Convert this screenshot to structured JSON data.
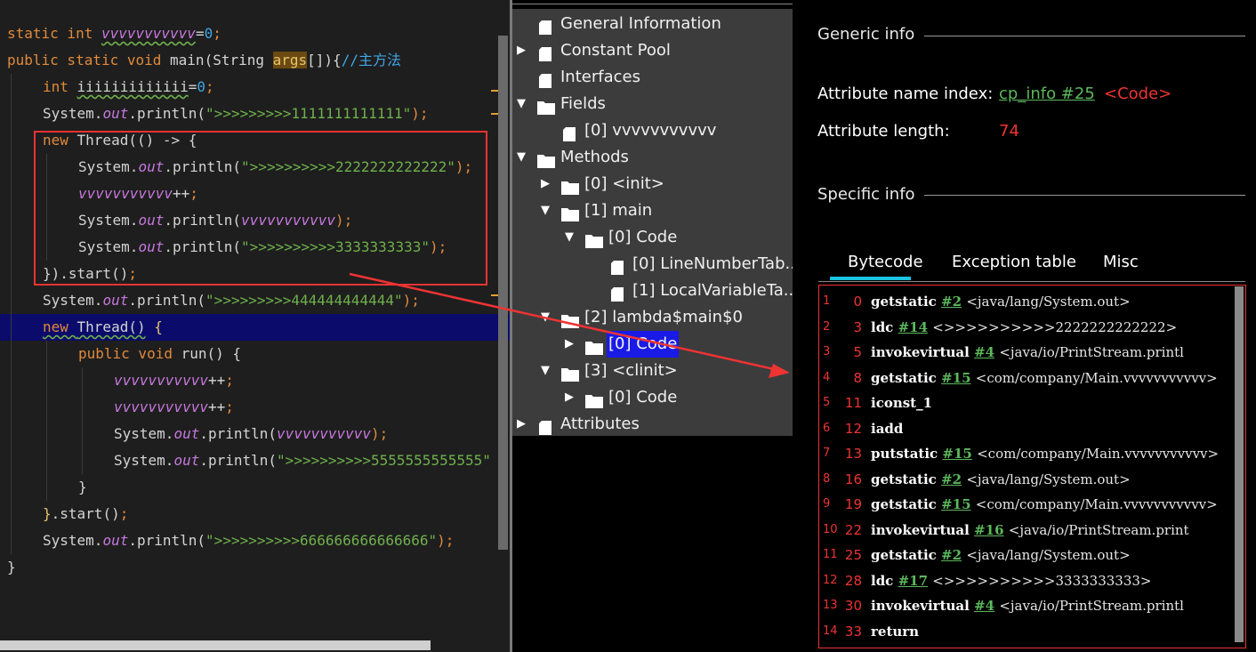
{
  "editor": {
    "lines": [
      {
        "indent": 0,
        "highlight": false,
        "tokens": [
          {
            "t": "static int ",
            "c": "kw"
          },
          {
            "t": "vvvvvvvvvvv",
            "c": "var",
            "w": true
          },
          {
            "t": "=",
            "c": "punc"
          },
          {
            "t": "0",
            "c": "num"
          },
          {
            "t": ";",
            "c": "semi"
          }
        ]
      },
      {
        "indent": 0,
        "highlight": false,
        "tokens": [
          {
            "t": "public static void ",
            "c": "kw"
          },
          {
            "t": "main",
            "c": "fn"
          },
          {
            "t": "(String ",
            "c": "punc"
          },
          {
            "t": "args",
            "c": "arg"
          },
          {
            "t": "[]){",
            "c": "punc"
          },
          {
            "t": "//主方法",
            "c": "cmt"
          }
        ]
      },
      {
        "indent": 1,
        "highlight": false,
        "tokens": [
          {
            "t": "int ",
            "c": "kw"
          },
          {
            "t": "iiiiiiiiiiiii",
            "c": "punc",
            "w": true
          },
          {
            "t": "=",
            "c": "punc"
          },
          {
            "t": "0",
            "c": "num"
          },
          {
            "t": ";",
            "c": "semi"
          }
        ]
      },
      {
        "indent": 1,
        "highlight": false,
        "tokens": [
          {
            "t": "System.",
            "c": "punc"
          },
          {
            "t": "out",
            "c": "field"
          },
          {
            "t": ".println(",
            "c": "punc"
          },
          {
            "t": "\">>>>>>>>>1111111111111\"",
            "c": "str"
          },
          {
            "t": ");",
            "c": "semi"
          }
        ]
      },
      {
        "indent": 1,
        "highlight": false,
        "tokens": [
          {
            "t": "new ",
            "c": "kw"
          },
          {
            "t": "Thread(() -> {",
            "c": "punc"
          }
        ]
      },
      {
        "indent": 2,
        "highlight": false,
        "tokens": [
          {
            "t": "System.",
            "c": "punc"
          },
          {
            "t": "out",
            "c": "field"
          },
          {
            "t": ".println(",
            "c": "punc"
          },
          {
            "t": "\">>>>>>>>>>2222222222222\"",
            "c": "str"
          },
          {
            "t": ");",
            "c": "semi"
          }
        ]
      },
      {
        "indent": 2,
        "highlight": false,
        "tokens": [
          {
            "t": "vvvvvvvvvvv",
            "c": "var"
          },
          {
            "t": "++",
            "c": "punc"
          },
          {
            "t": ";",
            "c": "semi"
          }
        ]
      },
      {
        "indent": 2,
        "highlight": false,
        "tokens": [
          {
            "t": "System.",
            "c": "punc"
          },
          {
            "t": "out",
            "c": "field"
          },
          {
            "t": ".println(",
            "c": "punc"
          },
          {
            "t": "vvvvvvvvvvv",
            "c": "var"
          },
          {
            "t": ");",
            "c": "semi"
          }
        ]
      },
      {
        "indent": 2,
        "highlight": false,
        "tokens": [
          {
            "t": "System.",
            "c": "punc"
          },
          {
            "t": "out",
            "c": "field"
          },
          {
            "t": ".println(",
            "c": "punc"
          },
          {
            "t": "\">>>>>>>>>>3333333333\"",
            "c": "str"
          },
          {
            "t": ");",
            "c": "semi"
          }
        ]
      },
      {
        "indent": 1,
        "highlight": false,
        "tokens": [
          {
            "t": "}).start()",
            "c": "punc"
          },
          {
            "t": ";",
            "c": "semi"
          }
        ]
      },
      {
        "indent": 1,
        "highlight": false,
        "tokens": [
          {
            "t": "System.",
            "c": "punc"
          },
          {
            "t": "out",
            "c": "field"
          },
          {
            "t": ".println(",
            "c": "punc"
          },
          {
            "t": "\">>>>>>>>>444444444444\"",
            "c": "str"
          },
          {
            "t": ");",
            "c": "semi"
          }
        ]
      },
      {
        "indent": 1,
        "highlight": true,
        "tokens": [
          {
            "t": "new ",
            "c": "kw",
            "w": true
          },
          {
            "t": "Thread()",
            "c": "punc",
            "w": true
          },
          {
            "t": " {",
            "c": "brace"
          }
        ]
      },
      {
        "indent": 2,
        "highlight": false,
        "tokens": [
          {
            "t": "public void ",
            "c": "kw"
          },
          {
            "t": "run",
            "c": "fn"
          },
          {
            "t": "() {",
            "c": "punc"
          }
        ]
      },
      {
        "indent": 3,
        "highlight": false,
        "tokens": [
          {
            "t": "vvvvvvvvvvv",
            "c": "var"
          },
          {
            "t": "++",
            "c": "punc"
          },
          {
            "t": ";",
            "c": "semi"
          }
        ]
      },
      {
        "indent": 3,
        "highlight": false,
        "tokens": [
          {
            "t": "vvvvvvvvvvv",
            "c": "var"
          },
          {
            "t": "++",
            "c": "punc"
          },
          {
            "t": ";",
            "c": "semi"
          }
        ]
      },
      {
        "indent": 3,
        "highlight": false,
        "tokens": [
          {
            "t": "System.",
            "c": "punc"
          },
          {
            "t": "out",
            "c": "field"
          },
          {
            "t": ".println(",
            "c": "punc"
          },
          {
            "t": "vvvvvvvvvvv",
            "c": "var"
          },
          {
            "t": ");",
            "c": "semi"
          }
        ]
      },
      {
        "indent": 3,
        "highlight": false,
        "tokens": [
          {
            "t": "System.",
            "c": "punc"
          },
          {
            "t": "out",
            "c": "field"
          },
          {
            "t": ".println(",
            "c": "punc"
          },
          {
            "t": "\">>>>>>>>>>5555555555555\"",
            "c": "str"
          }
        ]
      },
      {
        "indent": 2,
        "highlight": false,
        "tokens": [
          {
            "t": "}",
            "c": "punc"
          }
        ]
      },
      {
        "indent": 1,
        "highlight": false,
        "tokens": [
          {
            "t": "}",
            "c": "brace"
          },
          {
            "t": ".start()",
            "c": "punc"
          },
          {
            "t": ";",
            "c": "semi"
          }
        ]
      },
      {
        "indent": 1,
        "highlight": false,
        "tokens": [
          {
            "t": "System.",
            "c": "punc"
          },
          {
            "t": "out",
            "c": "field"
          },
          {
            "t": ".println(",
            "c": "punc"
          },
          {
            "t": "\">>>>>>>>>>666666666666666\"",
            "c": "str"
          },
          {
            "t": ");",
            "c": "semi"
          }
        ]
      },
      {
        "indent": 0,
        "highlight": false,
        "tokens": [
          {
            "t": "}",
            "c": "punc"
          }
        ]
      }
    ]
  },
  "tree": {
    "items": [
      {
        "label": "General Information",
        "level": 0,
        "twisty": "",
        "icon": "file",
        "selected": false
      },
      {
        "label": "Constant Pool",
        "level": 0,
        "twisty": "collapsed",
        "icon": "file",
        "selected": false
      },
      {
        "label": "Interfaces",
        "level": 0,
        "twisty": "",
        "icon": "file",
        "selected": false
      },
      {
        "label": "Fields",
        "level": 0,
        "twisty": "expanded",
        "icon": "folder",
        "selected": false
      },
      {
        "label": "[0] vvvvvvvvvvv",
        "level": 1,
        "twisty": "",
        "icon": "file",
        "selected": false
      },
      {
        "label": "Methods",
        "level": 0,
        "twisty": "expanded",
        "icon": "folder",
        "selected": false
      },
      {
        "label": "[0] <init>",
        "level": 1,
        "twisty": "collapsed",
        "icon": "folder",
        "selected": false
      },
      {
        "label": "[1] main",
        "level": 1,
        "twisty": "expanded",
        "icon": "folder",
        "selected": false
      },
      {
        "label": "[0] Code",
        "level": 2,
        "twisty": "expanded",
        "icon": "folder",
        "selected": false
      },
      {
        "label": "[0] LineNumberTab...",
        "level": 3,
        "twisty": "",
        "icon": "file",
        "selected": false
      },
      {
        "label": "[1] LocalVariableTa...",
        "level": 3,
        "twisty": "",
        "icon": "file",
        "selected": false
      },
      {
        "label": "[2] lambda$main$0",
        "level": 1,
        "twisty": "expanded",
        "icon": "folder",
        "selected": false
      },
      {
        "label": "[0] Code",
        "level": 2,
        "twisty": "collapsed",
        "icon": "folder",
        "selected": true
      },
      {
        "label": "[3] <clinit>",
        "level": 1,
        "twisty": "expanded",
        "icon": "folder",
        "selected": false
      },
      {
        "label": "[0] Code",
        "level": 2,
        "twisty": "collapsed",
        "icon": "folder",
        "selected": false
      },
      {
        "label": "Attributes",
        "level": 0,
        "twisty": "collapsed",
        "icon": "file",
        "selected": false
      }
    ]
  },
  "details": {
    "generic_title": "Generic info",
    "attr_name_label": "Attribute name index:",
    "attr_name_link": "cp_info #25",
    "attr_name_value": "<Code>",
    "attr_len_label": "Attribute length:",
    "attr_len_value": "74",
    "specific_title": "Specific info",
    "tabs": [
      "Bytecode",
      "Exception table",
      "Misc"
    ],
    "bytecode": [
      {
        "ln": "1",
        "off": "0",
        "op": "getstatic",
        "ref": "#2",
        "cmt": "<java/lang/System.out>"
      },
      {
        "ln": "2",
        "off": "3",
        "op": "ldc",
        "ref": "#14",
        "cmt": "<>>>>>>>>>>2222222222222>"
      },
      {
        "ln": "3",
        "off": "5",
        "op": "invokevirtual",
        "ref": "#4",
        "cmt": "<java/io/PrintStream.printl"
      },
      {
        "ln": "4",
        "off": "8",
        "op": "getstatic",
        "ref": "#15",
        "cmt": "<com/company/Main.vvvvvvvvvvv>"
      },
      {
        "ln": "5",
        "off": "11",
        "op": "iconst_1",
        "ref": "",
        "cmt": ""
      },
      {
        "ln": "6",
        "off": "12",
        "op": "iadd",
        "ref": "",
        "cmt": ""
      },
      {
        "ln": "7",
        "off": "13",
        "op": "putstatic",
        "ref": "#15",
        "cmt": "<com/company/Main.vvvvvvvvvvv>"
      },
      {
        "ln": "8",
        "off": "16",
        "op": "getstatic",
        "ref": "#2",
        "cmt": "<java/lang/System.out>"
      },
      {
        "ln": "9",
        "off": "19",
        "op": "getstatic",
        "ref": "#15",
        "cmt": "<com/company/Main.vvvvvvvvvvv>"
      },
      {
        "ln": "10",
        "off": "22",
        "op": "invokevirtual",
        "ref": "#16",
        "cmt": "<java/io/PrintStream.print"
      },
      {
        "ln": "11",
        "off": "25",
        "op": "getstatic",
        "ref": "#2",
        "cmt": "<java/lang/System.out>"
      },
      {
        "ln": "12",
        "off": "28",
        "op": "ldc",
        "ref": "#17",
        "cmt": "<>>>>>>>>>>3333333333>"
      },
      {
        "ln": "13",
        "off": "30",
        "op": "invokevirtual",
        "ref": "#4",
        "cmt": "<java/io/PrintStream.printl"
      },
      {
        "ln": "14",
        "off": "33",
        "op": "return",
        "ref": "",
        "cmt": ""
      }
    ]
  },
  "colors": {
    "annotation": "#e33",
    "selection": "#1a1ae6",
    "tab_accent": "#19c4e0",
    "link": "#5cb85c"
  }
}
